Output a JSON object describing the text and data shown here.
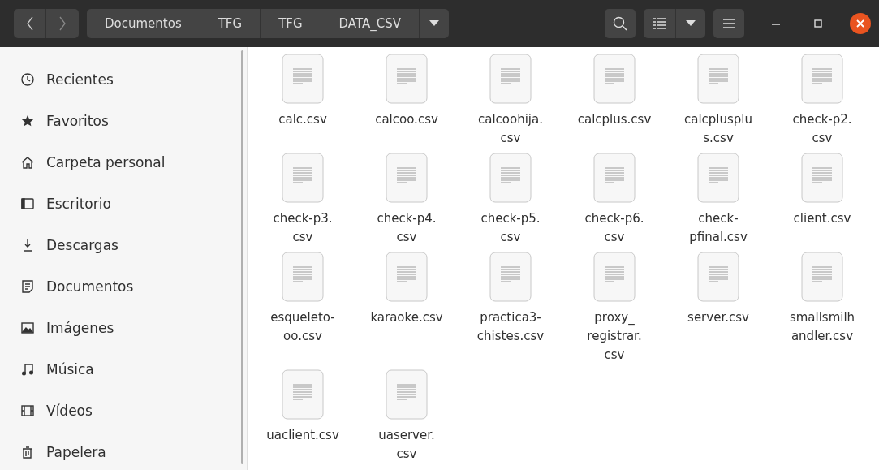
{
  "header": {
    "breadcrumbs": [
      "Documentos",
      "TFG",
      "TFG",
      "DATA_CSV"
    ]
  },
  "sidebar": {
    "items": [
      {
        "label": "Recientes",
        "kind": "recent"
      },
      {
        "label": "Favoritos",
        "kind": "star"
      },
      {
        "label": "Carpeta personal",
        "kind": "home"
      },
      {
        "label": "Escritorio",
        "kind": "desktop"
      },
      {
        "label": "Descargas",
        "kind": "download"
      },
      {
        "label": "Documentos",
        "kind": "document"
      },
      {
        "label": "Imágenes",
        "kind": "image"
      },
      {
        "label": "Música",
        "kind": "music"
      },
      {
        "label": "Vídeos",
        "kind": "video"
      },
      {
        "label": "Papelera",
        "kind": "trash"
      }
    ]
  },
  "files": [
    {
      "lines": [
        "calc.csv"
      ]
    },
    {
      "lines": [
        "calcoo.csv"
      ]
    },
    {
      "lines": [
        "calcoohija.",
        "csv"
      ]
    },
    {
      "lines": [
        "calcplus.csv"
      ]
    },
    {
      "lines": [
        "calcplusplu",
        "s.csv"
      ]
    },
    {
      "lines": [
        "check-p2.",
        "csv"
      ]
    },
    {
      "lines": [
        "check-p3.",
        "csv"
      ]
    },
    {
      "lines": [
        "check-p4.",
        "csv"
      ]
    },
    {
      "lines": [
        "check-p5.",
        "csv"
      ]
    },
    {
      "lines": [
        "check-p6.",
        "csv"
      ]
    },
    {
      "lines": [
        "check-",
        "pfinal.csv"
      ]
    },
    {
      "lines": [
        "client.csv"
      ]
    },
    {
      "lines": [
        "esqueleto-",
        "oo.csv"
      ]
    },
    {
      "lines": [
        "karaoke.csv"
      ]
    },
    {
      "lines": [
        "practica3-",
        "chistes.csv"
      ]
    },
    {
      "lines": [
        "proxy_",
        "registrar.",
        "csv"
      ]
    },
    {
      "lines": [
        "server.csv"
      ]
    },
    {
      "lines": [
        "smallsmilh",
        "andler.csv"
      ]
    },
    {
      "lines": [
        "uaclient.csv"
      ]
    },
    {
      "lines": [
        "uaserver.",
        "csv"
      ]
    }
  ]
}
